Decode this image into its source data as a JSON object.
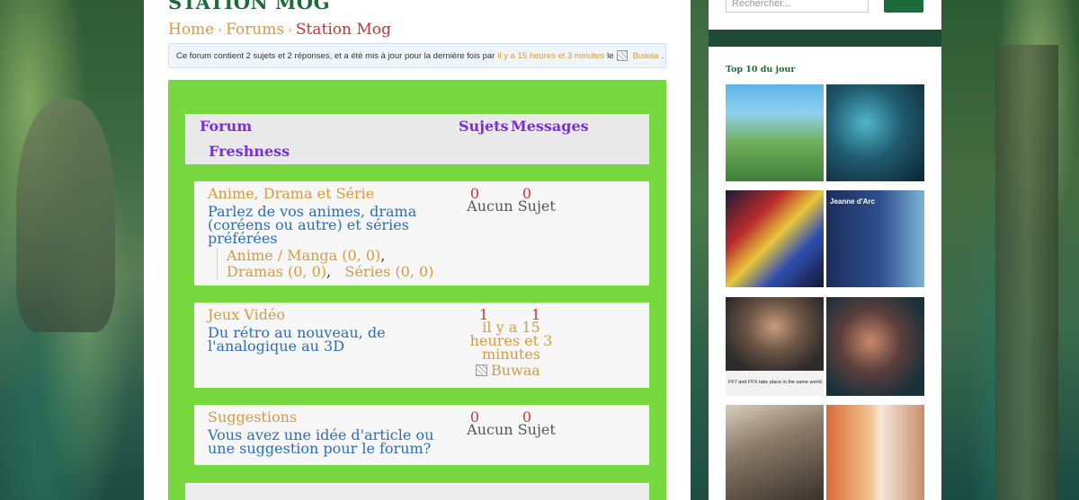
{
  "site": {
    "title": "STATION MOG"
  },
  "breadcrumb": {
    "items": [
      "Home",
      "Forums"
    ],
    "current": "Station Mog",
    "separator": "›"
  },
  "info": {
    "prefix": "Ce forum contient 2 sujets et 2 réponses, et a été mis à jour pour la dernière fois par",
    "freshness_link": "il y a 15 heures et 3 minutes",
    "middle": "le",
    "user": "Buwaa",
    "suffix": "."
  },
  "forum_table": {
    "headers": {
      "forum": "Forum",
      "sujets": "Sujets",
      "messages": "Messages",
      "freshness": "Freshness"
    },
    "rows": [
      {
        "title": "Anime, Drama et Série",
        "description": "Parlez de vos animes, drama (coréens ou autre) et séries préférées",
        "subforums": [
          "Anime / Manga (0, 0)",
          "Dramas (0, 0)",
          "Séries (0, 0)"
        ],
        "sujets": "0",
        "messages": "0",
        "freshness": "Aucun Sujet"
      },
      {
        "title": "Jeux Vidéo",
        "description": "Du rétro au nouveau, de l'analogique au 3D",
        "sujets": "1",
        "messages": "1",
        "freshness": "il y a 15 heures et 3 minutes",
        "user": "Buwaa"
      },
      {
        "title": "Suggestions",
        "description": "Vous avez une idée d'article ou une suggestion pour le forum?",
        "sujets": "0",
        "messages": "0",
        "freshness": "Aucun Sujet"
      }
    ]
  },
  "sidebar": {
    "search_placeholder": "Rechercher...",
    "widget_title": "Top 10 du jour",
    "thumb_texts": {
      "jeanne": "Jeanne d'Arc",
      "ff_caption": "FF7 and FFX take place in the same world."
    }
  },
  "colors": {
    "accent_green": "#78d840",
    "brand_green": "#1e6b3a",
    "link_orange": "#d99a3f",
    "link_blue": "#2c6fb7",
    "header_purple": "#7b2ee0",
    "count_red": "#d03535"
  }
}
